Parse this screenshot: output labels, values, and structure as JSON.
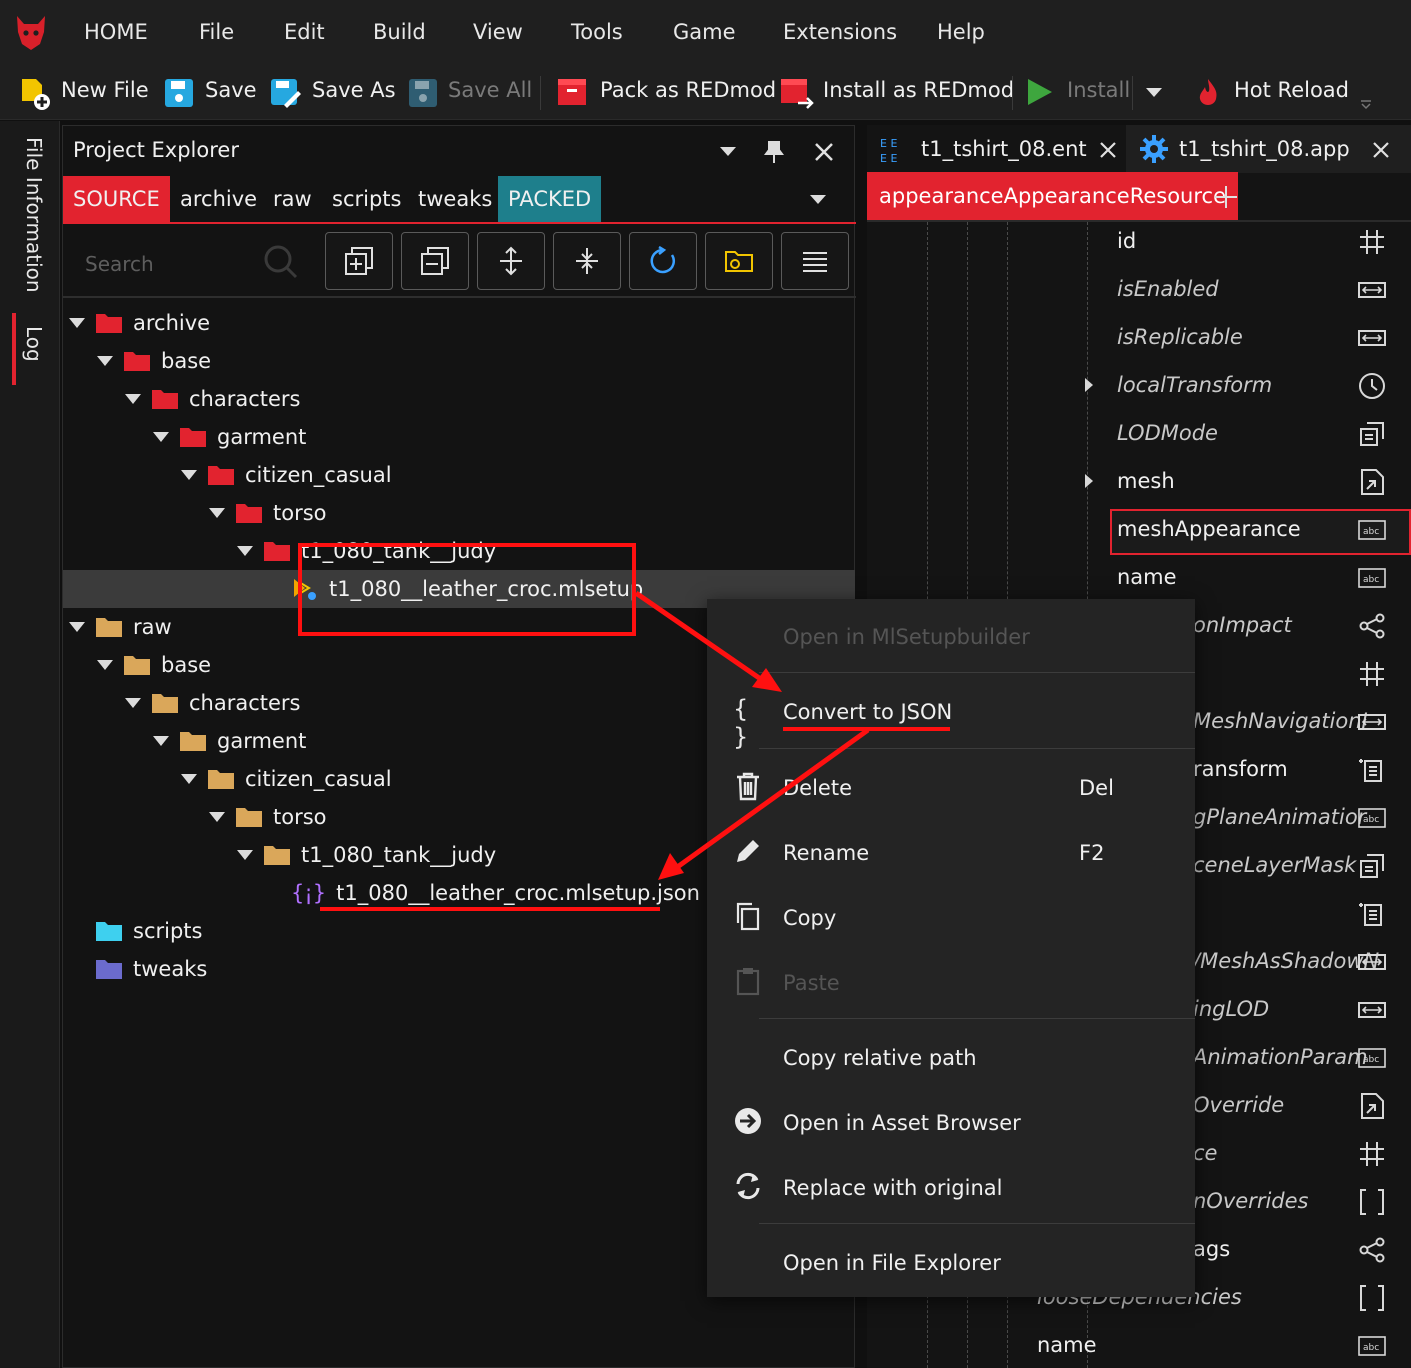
{
  "menu": [
    "HOME",
    "File",
    "Edit",
    "Build",
    "View",
    "Tools",
    "Game",
    "Extensions",
    "Help"
  ],
  "toolbar": {
    "new_file": "New File",
    "save": "Save",
    "save_as": "Save As",
    "save_all": "Save All",
    "pack": "Pack as REDmod",
    "install_redmod": "Install as REDmod",
    "install": "Install",
    "hot_reload": "Hot Reload"
  },
  "side": {
    "file_info": "File Information",
    "log": "Log"
  },
  "explorer": {
    "title": "Project Explorer",
    "tabs": [
      "SOURCE",
      "archive",
      "raw",
      "scripts",
      "tweaks",
      "PACKED"
    ],
    "search_placeholder": "Search",
    "tree": [
      {
        "label": "archive",
        "depth": 0,
        "type": "folder-red"
      },
      {
        "label": "base",
        "depth": 1,
        "type": "folder-red"
      },
      {
        "label": "characters",
        "depth": 2,
        "type": "folder-red"
      },
      {
        "label": "garment",
        "depth": 3,
        "type": "folder-red"
      },
      {
        "label": "citizen_casual",
        "depth": 4,
        "type": "folder-red"
      },
      {
        "label": "torso",
        "depth": 5,
        "type": "folder-red"
      },
      {
        "label": "t1_080_tank__judy",
        "depth": 6,
        "type": "folder-red"
      },
      {
        "label": "t1_080__leather_croc.mlsetup",
        "depth": 7,
        "type": "file-mlsetup"
      },
      {
        "label": "raw",
        "depth": 0,
        "type": "folder-tan"
      },
      {
        "label": "base",
        "depth": 1,
        "type": "folder-tan"
      },
      {
        "label": "characters",
        "depth": 2,
        "type": "folder-tan"
      },
      {
        "label": "garment",
        "depth": 3,
        "type": "folder-tan"
      },
      {
        "label": "citizen_casual",
        "depth": 4,
        "type": "folder-tan"
      },
      {
        "label": "torso",
        "depth": 5,
        "type": "folder-tan"
      },
      {
        "label": "t1_080_tank__judy",
        "depth": 6,
        "type": "folder-tan"
      },
      {
        "label": "t1_080__leather_croc.mlsetup.json",
        "depth": 7,
        "type": "file-json"
      },
      {
        "label": "scripts",
        "depth": 0,
        "type": "folder-cyan"
      },
      {
        "label": "tweaks",
        "depth": 0,
        "type": "folder-purple"
      }
    ]
  },
  "editor": {
    "tab1": "t1_tshirt_08.ent",
    "tab2": "t1_tshirt_08.app",
    "section": "appearanceAppearanceResource",
    "props": [
      {
        "label": "id",
        "italic": false
      },
      {
        "label": "isEnabled",
        "italic": true
      },
      {
        "label": "isReplicable",
        "italic": true
      },
      {
        "label": "localTransform",
        "italic": true
      },
      {
        "label": "LODMode",
        "italic": true
      },
      {
        "label": "mesh",
        "italic": false
      },
      {
        "label": "meshAppearance",
        "italic": false
      },
      {
        "label": "name",
        "italic": false
      },
      {
        "label": "onImpact",
        "italic": true
      },
      {
        "label": "",
        "italic": true
      },
      {
        "label": "MeshNavigationI",
        "italic": true
      },
      {
        "label": "ransform",
        "italic": false
      },
      {
        "label": "gPlaneAnimatior",
        "italic": true
      },
      {
        "label": "ceneLayerMask",
        "italic": true
      },
      {
        "label": "",
        "italic": false
      },
      {
        "label": "/MeshAsShadowN",
        "italic": true
      },
      {
        "label": "ingLOD",
        "italic": true
      },
      {
        "label": "AnimationParam",
        "italic": true
      },
      {
        "label": "Override",
        "italic": true
      },
      {
        "label": "ce",
        "italic": true
      },
      {
        "label": "nOverrides",
        "italic": true
      },
      {
        "label": "ags",
        "italic": false
      },
      {
        "label": "looseDependencies",
        "italic": true
      },
      {
        "label": "name",
        "italic": false
      }
    ]
  },
  "context_menu": {
    "open_ml": "Open in MlSetupbuilder",
    "convert": "Convert to JSON",
    "delete": "Delete",
    "delete_key": "Del",
    "rename": "Rename",
    "rename_key": "F2",
    "copy": "Copy",
    "paste": "Paste",
    "copy_rel": "Copy relative path",
    "open_asset": "Open in Asset Browser",
    "replace": "Replace with original",
    "open_explorer": "Open in File Explorer"
  },
  "colors": {
    "accent": "#e2232f",
    "packed": "#1e7f8c",
    "annotation": "#ff1010"
  }
}
